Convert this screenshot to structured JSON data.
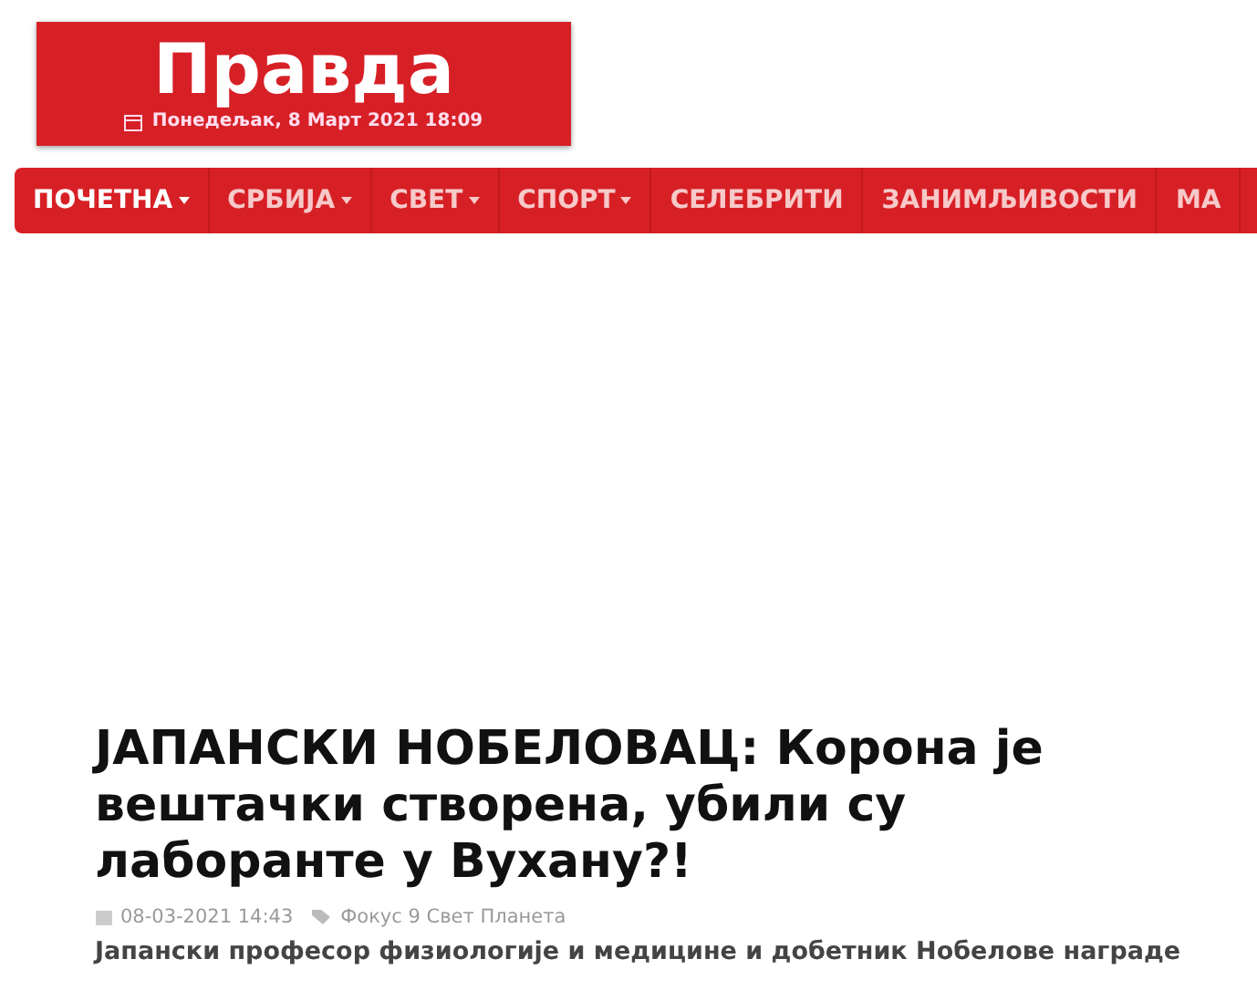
{
  "logo": {
    "title": "Правда",
    "date": "Понедељак, 8 Март 2021 18:09"
  },
  "nav": [
    {
      "label": "ПОЧЕТНА",
      "selected": true,
      "dropdown": true
    },
    {
      "label": "СРБИЈА",
      "selected": false,
      "dropdown": true
    },
    {
      "label": "СВЕТ",
      "selected": false,
      "dropdown": true
    },
    {
      "label": "СПОРТ",
      "selected": false,
      "dropdown": true
    },
    {
      "label": "СЕЛЕБРИТИ",
      "selected": false,
      "dropdown": false
    },
    {
      "label": "ЗАНИМЉИВОСТИ",
      "selected": false,
      "dropdown": false
    },
    {
      "label": "МА",
      "selected": false,
      "dropdown": false
    }
  ],
  "article": {
    "headline": "ЈАПАНСКИ НОБЕЛОВАЦ: Корона је вештачки створена, убили су лаборанте у Вухану?!",
    "date": "08-03-2021 14:43",
    "tags": "Фокус 9 Свет Планета",
    "lead": "Јапански професор физиологије и медицине и добетник Нобелове награде"
  }
}
